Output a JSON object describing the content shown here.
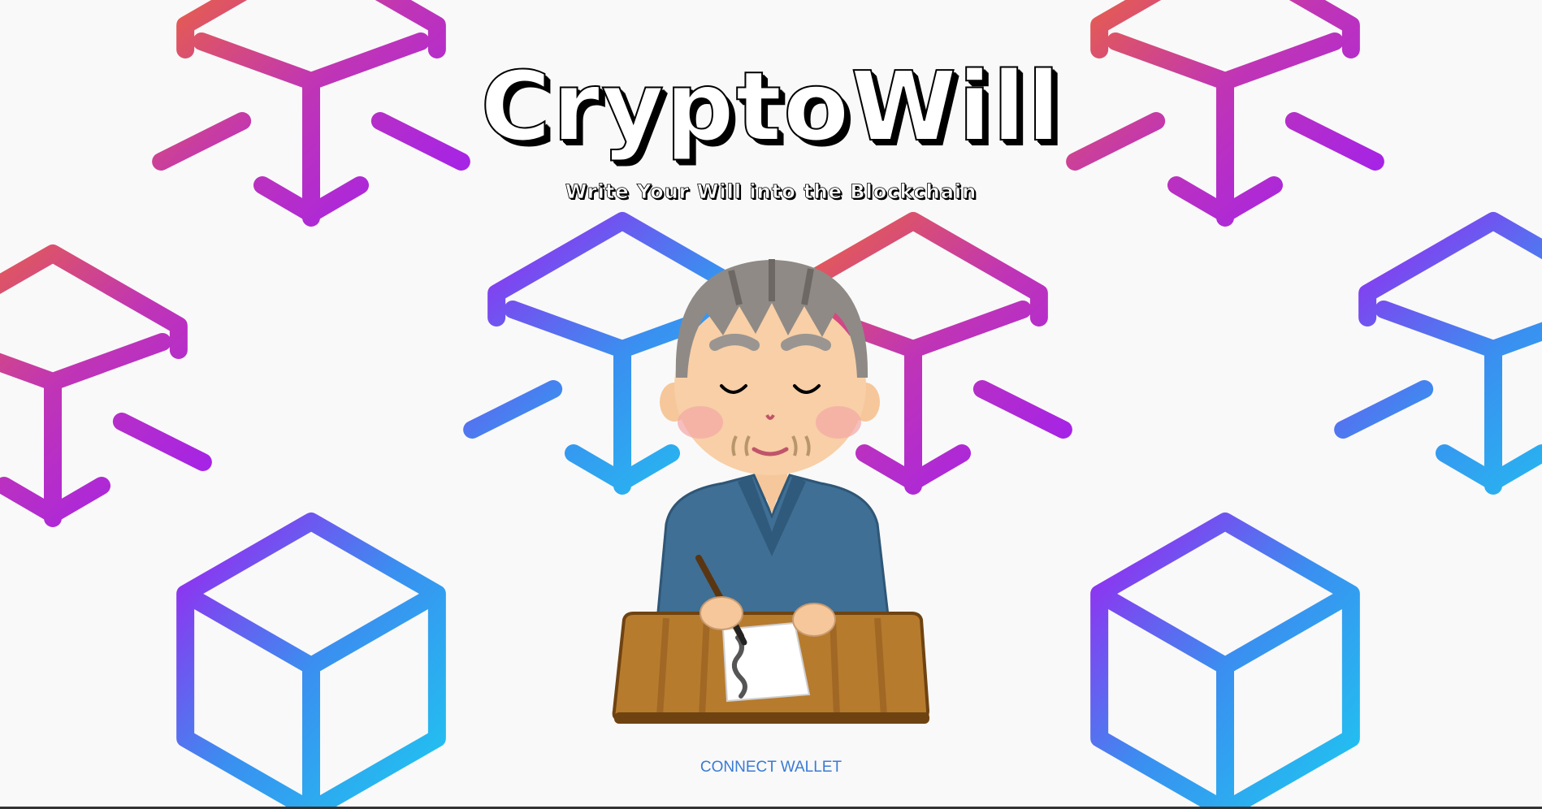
{
  "app": {
    "title": "CryptoWill",
    "tagline": "Write Your Will into the Blockchain"
  },
  "actions": {
    "connect_wallet_label": "CONNECT WALLET"
  },
  "background": {
    "pattern": "blockchain-cube-pattern",
    "colors": {
      "orange": "#f26a2e",
      "magenta": "#c035b5",
      "violet": "#a020f0",
      "blue": "#3a8ff0",
      "cyan": "#1ec8f0",
      "page": "#f9f9f9"
    }
  },
  "illustration": {
    "icon": "elderly-man-writing-will-icon"
  },
  "colors": {
    "link": "#3a7bd5"
  }
}
